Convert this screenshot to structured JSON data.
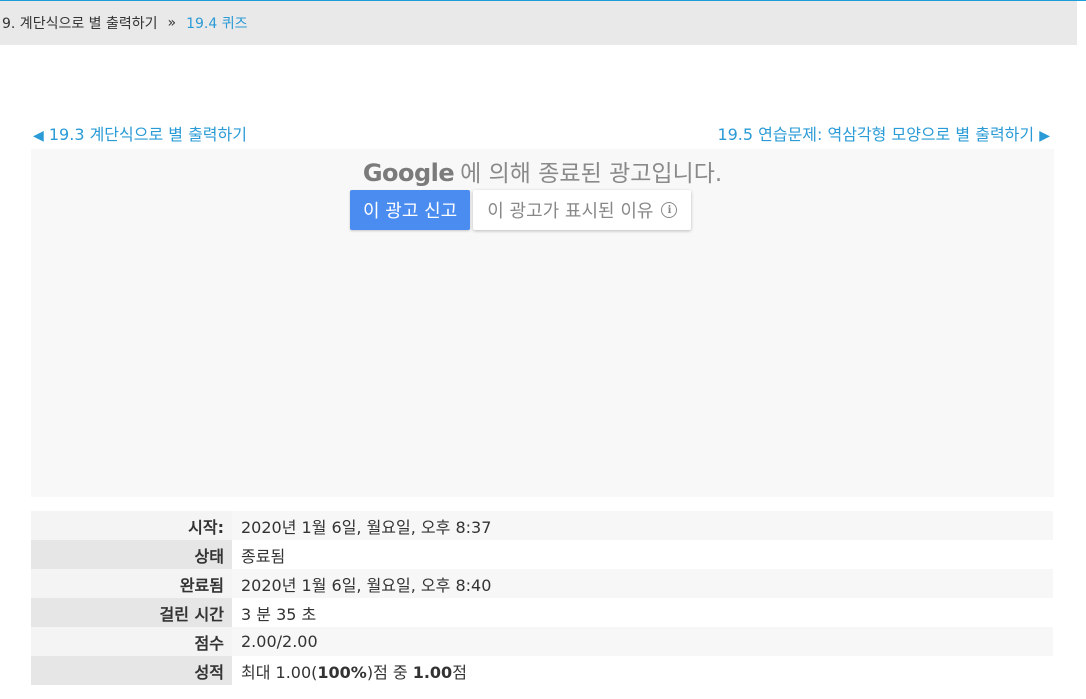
{
  "breadcrumb": {
    "parent": "9. 계단식으로 별 출력하기",
    "separator": "»",
    "current": "19.4 퀴즈"
  },
  "nav": {
    "prev_label": "19.3 계단식으로 별 출력하기",
    "next_label": "19.5 연습문제: 역삼각형 모양으로 별 출력하기",
    "prev_arrow": "◀",
    "next_arrow": "▶"
  },
  "ad": {
    "brand": "Google",
    "title": "에 의해 종료된 광고입니다.",
    "report_button": "이 광고 신고",
    "why_button": "이 광고가 표시된 이유",
    "info_symbol": "i"
  },
  "summary": {
    "start_label": "시작:",
    "start_value": "2020년 1월 6일, 월요일, 오후 8:37",
    "state_label": "상태",
    "state_value": "종료됨",
    "completed_label": "완료됨",
    "completed_value": "2020년 1월 6일, 월요일, 오후 8:40",
    "time_label": "걸린 시간",
    "time_value": "3 분 35 초",
    "score_label": "점수",
    "score_value": "2.00/2.00",
    "grade_label": "성적",
    "grade_prefix": "최대 1.00(",
    "grade_percent": "100%",
    "grade_mid": ")점 중 ",
    "grade_score": "1.00",
    "grade_suffix": "점"
  },
  "colors": {
    "accent": "#2a9bd6",
    "report_button": "#4a8cf0"
  }
}
